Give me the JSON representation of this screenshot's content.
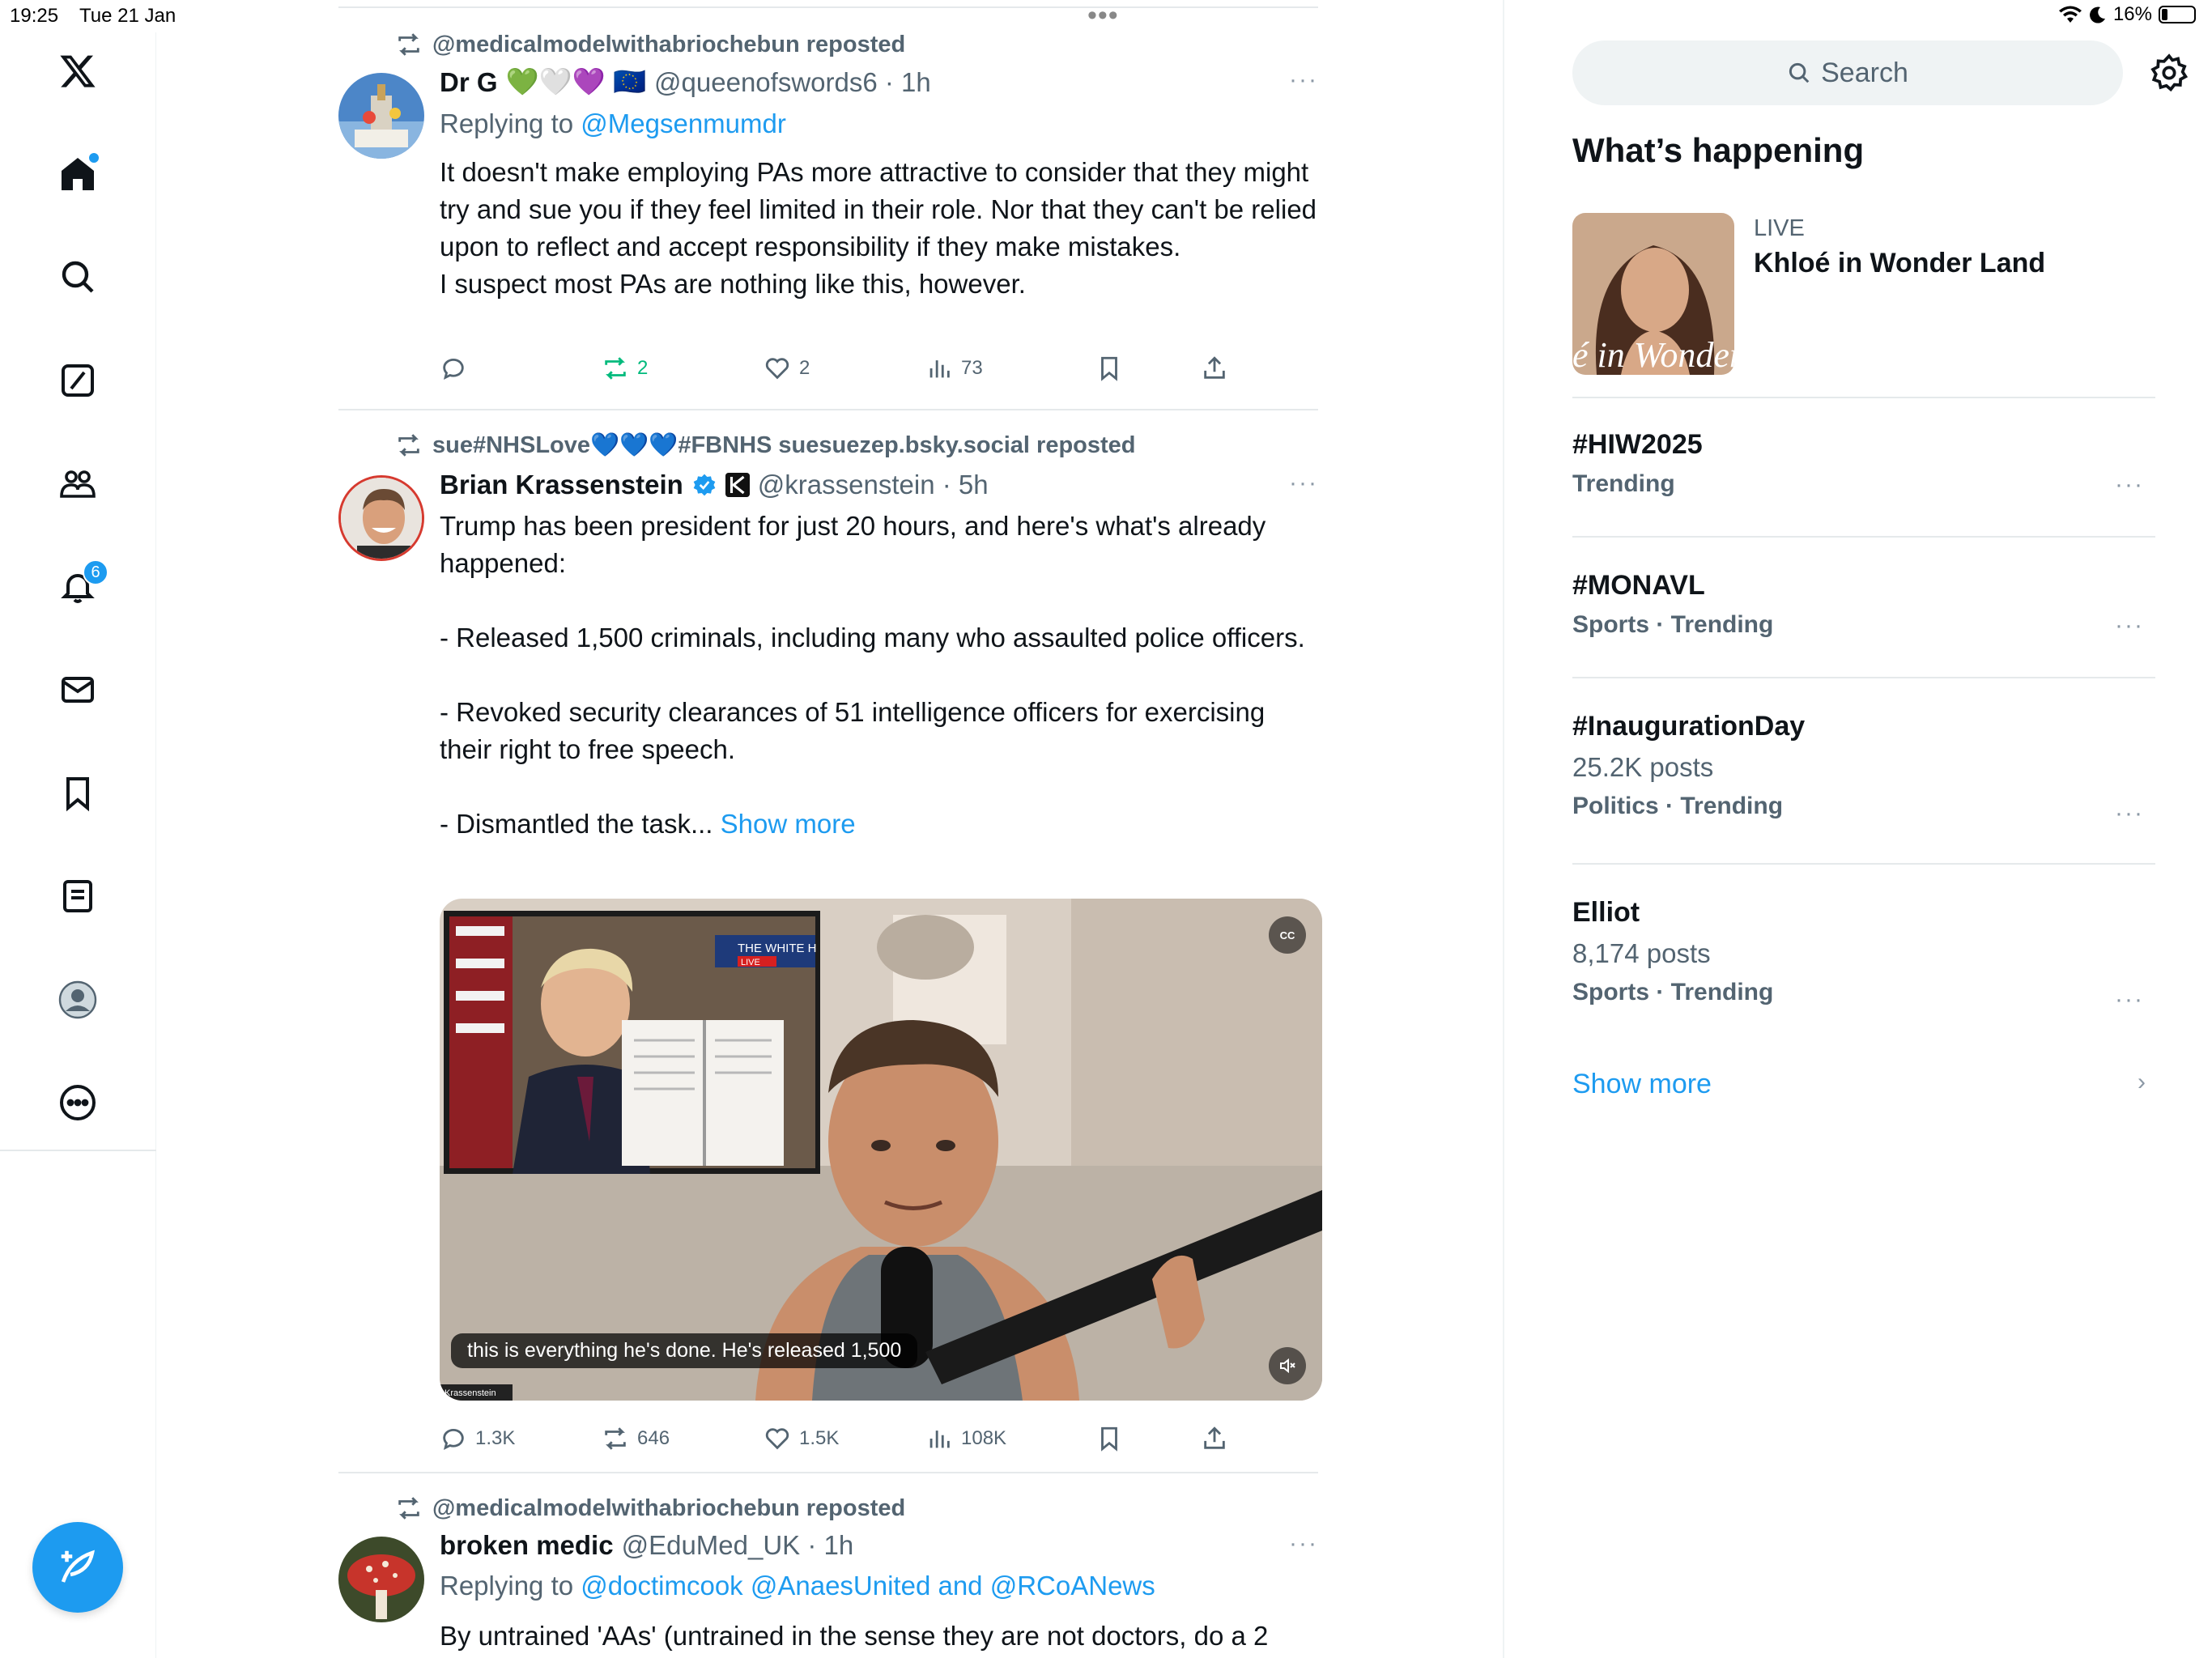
{
  "status_bar": {
    "time": "19:25",
    "date": "Tue 21 Jan",
    "battery": "16%"
  },
  "nav": {
    "notifications_badge": "6"
  },
  "tweets": [
    {
      "reposted_by": "@medicalmodelwithabriochebun reposted",
      "name": "Dr G",
      "emojis": "💚🤍💜 🇪🇺",
      "handle_time": "@queenofswords6 · 1h",
      "replying_label": "Replying to",
      "replying_to": "@Megsenmumdr",
      "text": "It doesn't make employing PAs more attractive to consider that they might try and sue you if they feel limited in their role. Nor that they can't be relied upon to reflect and accept responsibility if they make mistakes.\nI suspect most PAs are nothing like this, however.",
      "actions": {
        "reply": "",
        "retweet": "2",
        "like": "2",
        "views": "73"
      }
    },
    {
      "reposted_by": "sue#NHSLove💙💙💙#FBNHS suesuezep.bsky.social reposted",
      "name": "Brian Krassenstein",
      "handle_time": "@krassenstein · 5h",
      "text": "Trump has been president for just 20 hours, and here's what's already happened:\n\n- Released 1,500 criminals, including many who assaulted police officers.\n\n- Revoked security clearances of 51 intelligence officers for exercising their right to free speech.\n\n- Dismantled the task...",
      "show_more": "Show more",
      "video_caption": "this is everything he's done. He's released 1,500",
      "video_cc": "CC",
      "tv_banner": "THE WHITE H",
      "tv_live": "LIVE",
      "video_watermark": "Krassenstein",
      "actions": {
        "reply": "1.3K",
        "retweet": "646",
        "like": "1.5K",
        "views": "108K"
      }
    },
    {
      "reposted_by": "@medicalmodelwithabriochebun reposted",
      "name": "broken medic",
      "handle_time": "@EduMed_UK · 1h",
      "replying_label": "Replying to",
      "replying_to": "@doctimcook @AnaesUnited and @RCoANews",
      "text": "By untrained 'AAs' (untrained in the sense they are not doctors, do a 2"
    }
  ],
  "sidebar": {
    "search_placeholder": "Search",
    "section_title": "What’s happening",
    "live": {
      "label": "LIVE",
      "title": "Khloé in Wonder Land",
      "thumb_text": "é in Wonder l"
    },
    "trends": [
      {
        "name": "#HIW2025",
        "posts": "",
        "meta": "Trending"
      },
      {
        "name": "#MONAVL",
        "posts": "",
        "meta": "Sports · Trending"
      },
      {
        "name": "#InaugurationDay",
        "posts": "25.2K posts",
        "meta": "Politics · Trending"
      },
      {
        "name": "Elliot",
        "posts": "8,174 posts",
        "meta": "Sports · Trending"
      }
    ],
    "show_more": "Show more"
  },
  "colors": {
    "accent": "#1d9bf0",
    "retweet_green": "#00ba7c",
    "muted": "#536471"
  }
}
